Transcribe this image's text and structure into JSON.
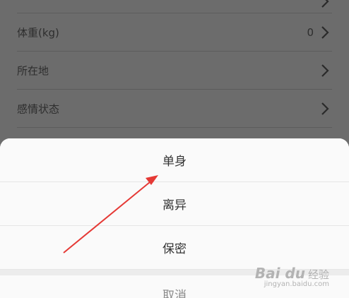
{
  "profile_rows": [
    {
      "label": "体重(kg)",
      "value": "0"
    },
    {
      "label": "所在地",
      "value": ""
    },
    {
      "label": "感情状态",
      "value": ""
    }
  ],
  "sheet": {
    "options": [
      "单身",
      "离异",
      "保密"
    ],
    "cancel_label": "取消"
  },
  "watermark": {
    "brand": "Bai du",
    "sub": "经验",
    "url": "jingyan.baidu.com"
  },
  "colors": {
    "overlay": "#6c6c6c",
    "sheet_bg": "#fafafa",
    "annotation_arrow": "#e53935"
  }
}
